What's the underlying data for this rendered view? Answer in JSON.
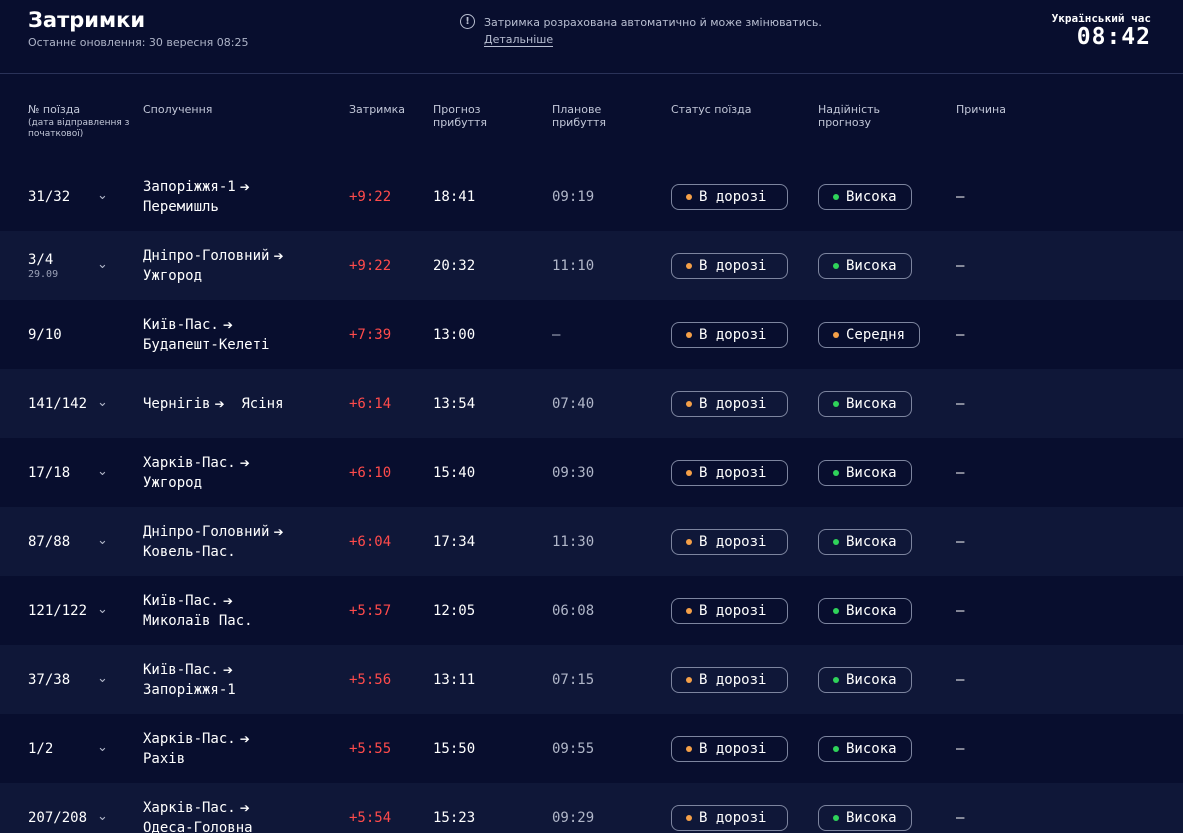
{
  "header": {
    "title": "Затримки",
    "updated": "Останнє оновлення: 30 вересня 08:25",
    "notice": "Затримка розрахована автоматично й може змінюватись.",
    "notice_link": "Детальніше",
    "clock_label": "Український час",
    "clock_time": "08:42"
  },
  "columns": {
    "train": "№ поїзда",
    "train_sub": "(дата відправлення з початкової)",
    "route": "Сполучення",
    "delay": "Затримка",
    "forecast": "Прогноз прибуття",
    "planned": "Планове прибуття",
    "status": "Статус поїзда",
    "reliability": "Надійність прогнозу",
    "reason": "Причина"
  },
  "colors": {
    "status_dot": "#f5a048",
    "high_dot": "#2fd35a",
    "medium_dot": "#f5a048"
  },
  "rows": [
    {
      "train": "31/32",
      "date": "",
      "expand": true,
      "from": "Запоріжжя-1",
      "to": "Перемишль",
      "inline": false,
      "delay": "+9:22",
      "forecast": "18:41",
      "planned": "09:19",
      "status": "В дорозі",
      "reliability": "Висока",
      "rel_level": "high",
      "reason": "—"
    },
    {
      "train": "3/4",
      "date": "29.09",
      "expand": true,
      "from": "Дніпро-Головний",
      "to": "Ужгород",
      "inline": false,
      "delay": "+9:22",
      "forecast": "20:32",
      "planned": "11:10",
      "status": "В дорозі",
      "reliability": "Висока",
      "rel_level": "high",
      "reason": "—"
    },
    {
      "train": "9/10",
      "date": "",
      "expand": false,
      "from": "Київ-Пас.",
      "to": "Будапешт-Келеті",
      "inline": false,
      "delay": "+7:39",
      "forecast": "13:00",
      "planned": "—",
      "status": "В дорозі",
      "reliability": "Середня",
      "rel_level": "medium",
      "reason": "—"
    },
    {
      "train": "141/142",
      "date": "",
      "expand": true,
      "from": "Чернігів",
      "to": "Ясіня",
      "inline": true,
      "delay": "+6:14",
      "forecast": "13:54",
      "planned": "07:40",
      "status": "В дорозі",
      "reliability": "Висока",
      "rel_level": "high",
      "reason": "—"
    },
    {
      "train": "17/18",
      "date": "",
      "expand": true,
      "from": "Харків-Пас.",
      "to": "Ужгород",
      "inline": false,
      "delay": "+6:10",
      "forecast": "15:40",
      "planned": "09:30",
      "status": "В дорозі",
      "reliability": "Висока",
      "rel_level": "high",
      "reason": "—"
    },
    {
      "train": "87/88",
      "date": "",
      "expand": true,
      "from": "Дніпро-Головний",
      "to": "Ковель-Пас.",
      "inline": false,
      "delay": "+6:04",
      "forecast": "17:34",
      "planned": "11:30",
      "status": "В дорозі",
      "reliability": "Висока",
      "rel_level": "high",
      "reason": "—"
    },
    {
      "train": "121/122",
      "date": "",
      "expand": true,
      "from": "Київ-Пас.",
      "to": "Миколаїв Пас.",
      "inline": false,
      "delay": "+5:57",
      "forecast": "12:05",
      "planned": "06:08",
      "status": "В дорозі",
      "reliability": "Висока",
      "rel_level": "high",
      "reason": "—"
    },
    {
      "train": "37/38",
      "date": "",
      "expand": true,
      "from": "Київ-Пас.",
      "to": "Запоріжжя-1",
      "inline": false,
      "delay": "+5:56",
      "forecast": "13:11",
      "planned": "07:15",
      "status": "В дорозі",
      "reliability": "Висока",
      "rel_level": "high",
      "reason": "—"
    },
    {
      "train": "1/2",
      "date": "",
      "expand": true,
      "from": "Харків-Пас.",
      "to": "Рахів",
      "inline": false,
      "delay": "+5:55",
      "forecast": "15:50",
      "planned": "09:55",
      "status": "В дорозі",
      "reliability": "Висока",
      "rel_level": "high",
      "reason": "—"
    },
    {
      "train": "207/208",
      "date": "",
      "expand": true,
      "from": "Харків-Пас.",
      "to": "Одеса-Головна",
      "inline": false,
      "delay": "+5:54",
      "forecast": "15:23",
      "planned": "09:29",
      "status": "В дорозі",
      "reliability": "Висока",
      "rel_level": "high",
      "reason": "—"
    }
  ]
}
